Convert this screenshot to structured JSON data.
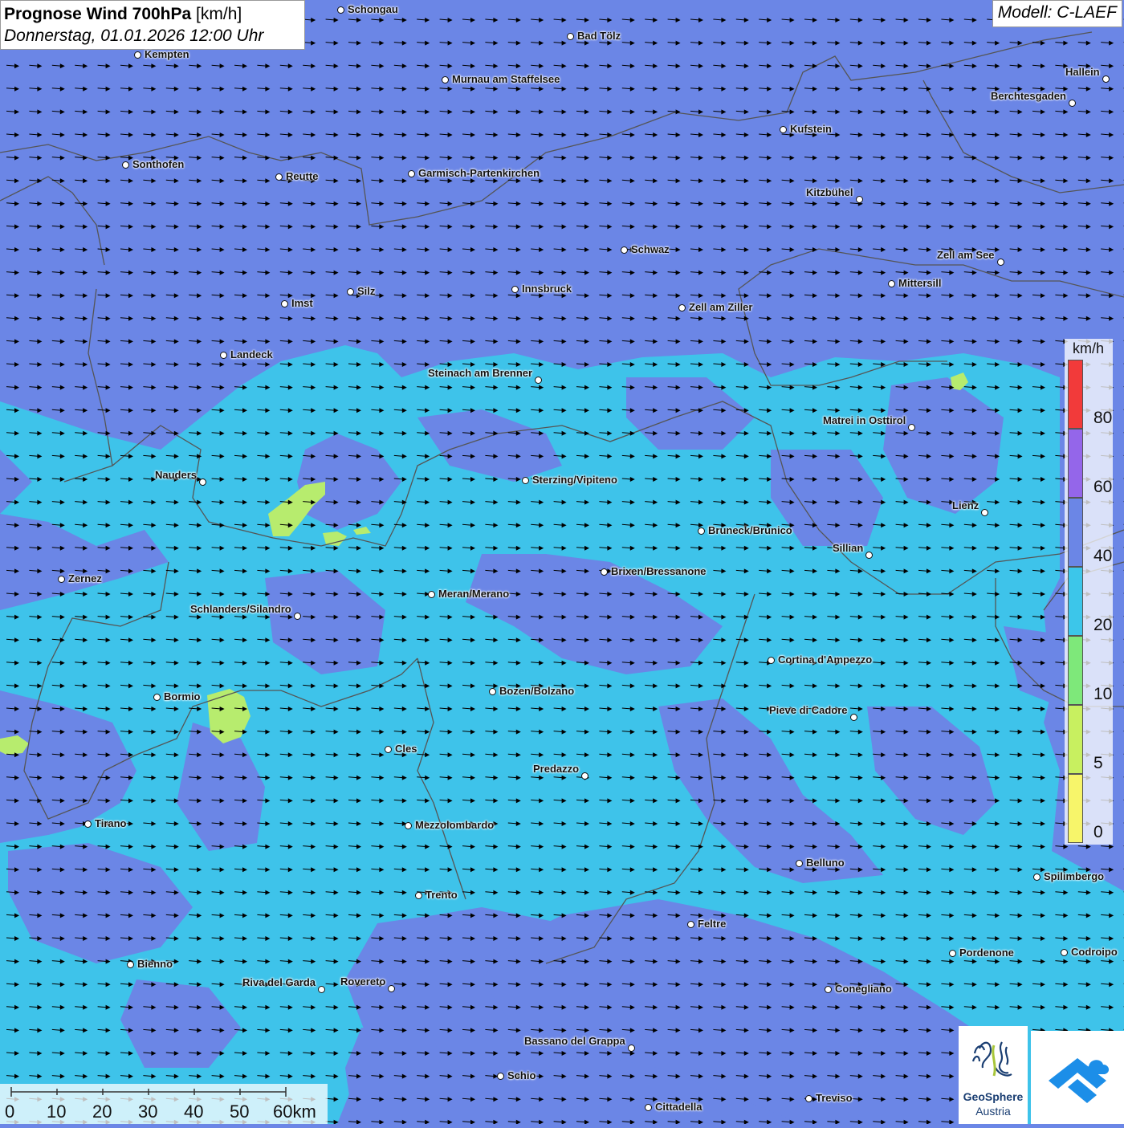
{
  "title": {
    "bold": "Prognose Wind 700hPa",
    "unit": " [km/h]",
    "date": "Donnerstag, 01.01.2026 12:00 Uhr"
  },
  "model": "Modell: C-LAEF",
  "legend": {
    "unit": "km/h",
    "classes": [
      {
        "label": "0",
        "color": "#f7f56a"
      },
      {
        "label": "5",
        "color": "#c8f060"
      },
      {
        "label": "10",
        "color": "#7ee87a"
      },
      {
        "label": "20",
        "color": "#3cc6ea"
      },
      {
        "label": "40",
        "color": "#6b86e6"
      },
      {
        "label": "60",
        "color": "#9466ea"
      },
      {
        "label": "80",
        "color": "#f23a3a"
      }
    ]
  },
  "scale": [
    "0",
    "10",
    "20",
    "30",
    "40",
    "50",
    "60km"
  ],
  "logo": {
    "name": "GeoSphere",
    "sub": "Austria"
  },
  "wind_direction": "west",
  "cities": [
    {
      "name": "Schongau"
    },
    {
      "name": "Bad Tölz"
    },
    {
      "name": "Kempten"
    },
    {
      "name": "Murnau am Staffelsee"
    },
    {
      "name": "Hallein"
    },
    {
      "name": "Berchtesgaden"
    },
    {
      "name": "Kufstein"
    },
    {
      "name": "Sonthofen"
    },
    {
      "name": "Reutte"
    },
    {
      "name": "Garmisch-Partenkirchen"
    },
    {
      "name": "Kitzbühel"
    },
    {
      "name": "Schwaz"
    },
    {
      "name": "Zell am See"
    },
    {
      "name": "Mittersill"
    },
    {
      "name": "Silz"
    },
    {
      "name": "Innsbruck"
    },
    {
      "name": "Imst"
    },
    {
      "name": "Zell am Ziller"
    },
    {
      "name": "Landeck"
    },
    {
      "name": "Steinach am Brenner"
    },
    {
      "name": "Matrei in Osttirol"
    },
    {
      "name": "Nauders"
    },
    {
      "name": "Sterzing/Vipiteno"
    },
    {
      "name": "Lienz"
    },
    {
      "name": "Bruneck/Brunico"
    },
    {
      "name": "Sillian"
    },
    {
      "name": "Brixen/Bressanone"
    },
    {
      "name": "Zernez"
    },
    {
      "name": "Meran/Merano"
    },
    {
      "name": "Schlanders/Silandro"
    },
    {
      "name": "Cortina d'Ampezzo"
    },
    {
      "name": "Bozen/Bolzano"
    },
    {
      "name": "Bormio"
    },
    {
      "name": "Pieve di Cadore"
    },
    {
      "name": "Cles"
    },
    {
      "name": "Predazzo"
    },
    {
      "name": "Tirano"
    },
    {
      "name": "Mezzolombardo"
    },
    {
      "name": "Belluno"
    },
    {
      "name": "Spilimbergo"
    },
    {
      "name": "Trento"
    },
    {
      "name": "Feltre"
    },
    {
      "name": "Pordenone"
    },
    {
      "name": "Codroipo"
    },
    {
      "name": "Bienno"
    },
    {
      "name": "Riva del Garda"
    },
    {
      "name": "Rovereto"
    },
    {
      "name": "Conegliano"
    },
    {
      "name": "Bassano del Grappa"
    },
    {
      "name": "Schio"
    },
    {
      "name": "Treviso"
    },
    {
      "name": "Cittadella"
    }
  ]
}
